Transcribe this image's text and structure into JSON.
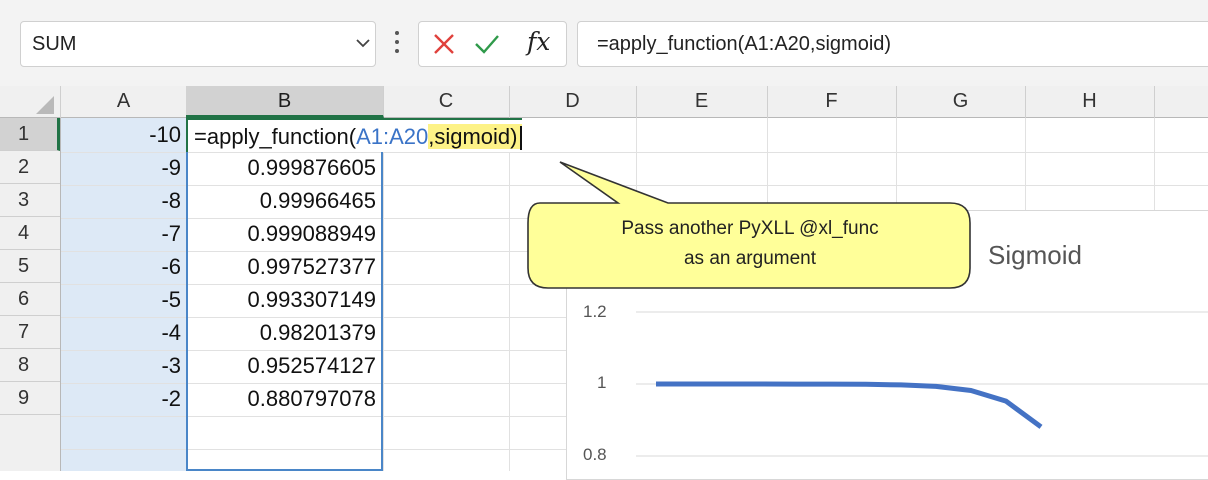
{
  "name_box": {
    "value": "SUM"
  },
  "formula_bar": {
    "cancel_icon": "x-icon",
    "enter_icon": "check-icon",
    "fx_label": "fx",
    "formula": "=apply_function(A1:A20,sigmoid)"
  },
  "columns": [
    "A",
    "B",
    "C",
    "D",
    "E",
    "F",
    "G",
    "H"
  ],
  "rows": [
    "1",
    "2",
    "3",
    "4",
    "5",
    "6",
    "7",
    "8",
    "9"
  ],
  "cells": {
    "A": [
      "-10",
      "-9",
      "-8",
      "-7",
      "-6",
      "-5",
      "-4",
      "-3",
      "-2"
    ],
    "B": [
      "",
      "0.999876605",
      "0.99966465",
      "0.999088949",
      "0.997527377",
      "0.993307149",
      "0.98201379",
      "0.952574127",
      "0.880797078"
    ]
  },
  "editing_cell": {
    "prefix": "=apply_function(",
    "range_ref": "A1:A20",
    "comma": ",",
    "func_name": "sigmoid",
    "suffix": ")"
  },
  "callout": {
    "line1": "Pass another PyXLL @xl_func",
    "line2": "as an argument"
  },
  "chart_data": {
    "type": "line",
    "title": "Sigmoid",
    "yticks": [
      "1.2",
      "1",
      "0.8"
    ],
    "ylim": [
      0.8,
      1.2
    ],
    "series": [
      {
        "values": [
          1.0,
          1.0,
          1.0,
          0.9999,
          0.9998,
          0.9997,
          0.9991,
          0.9975,
          0.9933,
          0.982,
          0.9526,
          0.8808
        ]
      }
    ]
  },
  "colors": {
    "accent": "#217346",
    "range_highlight": "#3a73c7",
    "callout_fill": "#ffff99",
    "chart_line": "#4472c4"
  }
}
